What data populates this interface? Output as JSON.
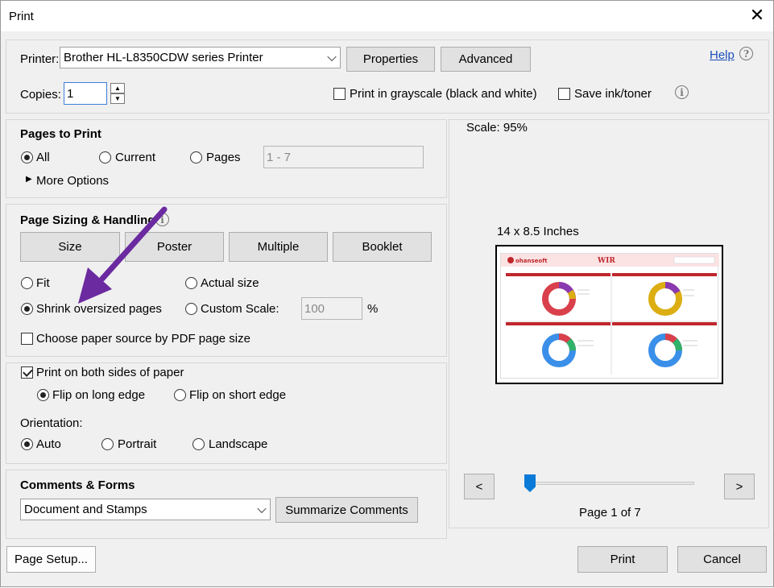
{
  "window": {
    "title": "Print",
    "close_glyph": "✕"
  },
  "printer": {
    "label": "Printer:",
    "selected": "Brother HL-L8350CDW series Printer",
    "properties_label": "Properties",
    "advanced_label": "Advanced",
    "help_label": "Help"
  },
  "copies": {
    "label": "Copies:",
    "value": "1",
    "grayscale_label": "Print in grayscale (black and white)",
    "grayscale_checked": false,
    "save_ink_label": "Save ink/toner",
    "save_ink_checked": false
  },
  "pages_to_print": {
    "title": "Pages to Print",
    "all_label": "All",
    "current_label": "Current",
    "pages_label": "Pages",
    "pages_range": "1 - 7",
    "selected": "All",
    "more_options_label": "More Options"
  },
  "page_sizing": {
    "title": "Page Sizing & Handling",
    "size_label": "Size",
    "poster_label": "Poster",
    "multiple_label": "Multiple",
    "booklet_label": "Booklet",
    "fit_label": "Fit",
    "actual_size_label": "Actual size",
    "shrink_label": "Shrink oversized pages",
    "custom_scale_label": "Custom Scale:",
    "custom_scale_value": "100",
    "percent": "%",
    "selected": "Shrink oversized pages",
    "paper_source_label": "Choose paper source by PDF page size",
    "paper_source_checked": false
  },
  "duplex": {
    "both_sides_label": "Print on both sides of paper",
    "both_sides_checked": true,
    "long_edge_label": "Flip on long edge",
    "short_edge_label": "Flip on short edge",
    "selected": "Flip on long edge"
  },
  "orientation": {
    "label": "Orientation:",
    "auto_label": "Auto",
    "portrait_label": "Portrait",
    "landscape_label": "Landscape",
    "selected": "Auto"
  },
  "comments": {
    "title": "Comments & Forms",
    "selected": "Document and Stamps",
    "summarize_label": "Summarize Comments"
  },
  "preview": {
    "scale_label": "Scale:  95%",
    "paper_size": "14 x 8.5 Inches",
    "prev_glyph": "<",
    "next_glyph": ">",
    "page_indicator": "Page 1 of 7",
    "slider_position": 0,
    "thumb_header": "WIR",
    "thumb_brand": "ohanseoft"
  },
  "footer": {
    "page_setup_label": "Page Setup...",
    "print_label": "Print",
    "cancel_label": "Cancel"
  },
  "colors": {
    "annotation_arrow": "#6b2aa0",
    "thumb_red": "#c0272d",
    "donut_red": "#d9404b",
    "donut_yellow": "#dcae12",
    "donut_blue": "#3a8fe8",
    "slider_accent": "#0a7ad8"
  }
}
